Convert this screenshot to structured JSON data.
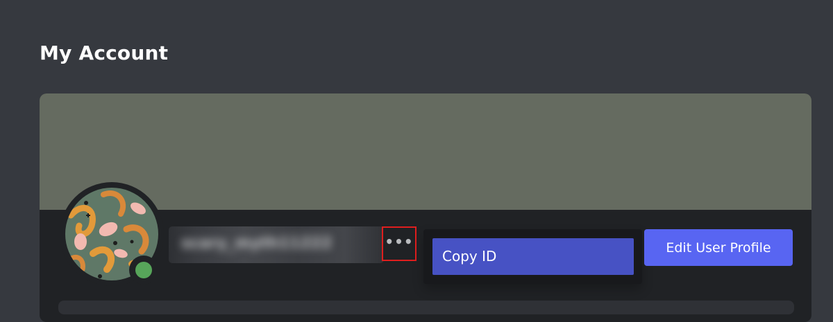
{
  "page": {
    "title": "My Account"
  },
  "profile": {
    "banner_color": "#656b60",
    "status": "online",
    "status_color": "#57a55a",
    "username_blurred": "scary_myth11222",
    "more_icon": "ellipsis-icon"
  },
  "context_menu": {
    "items": [
      {
        "label": "Copy ID"
      }
    ]
  },
  "actions": {
    "edit_profile_label": "Edit User Profile",
    "accent_color": "#5865f2"
  }
}
